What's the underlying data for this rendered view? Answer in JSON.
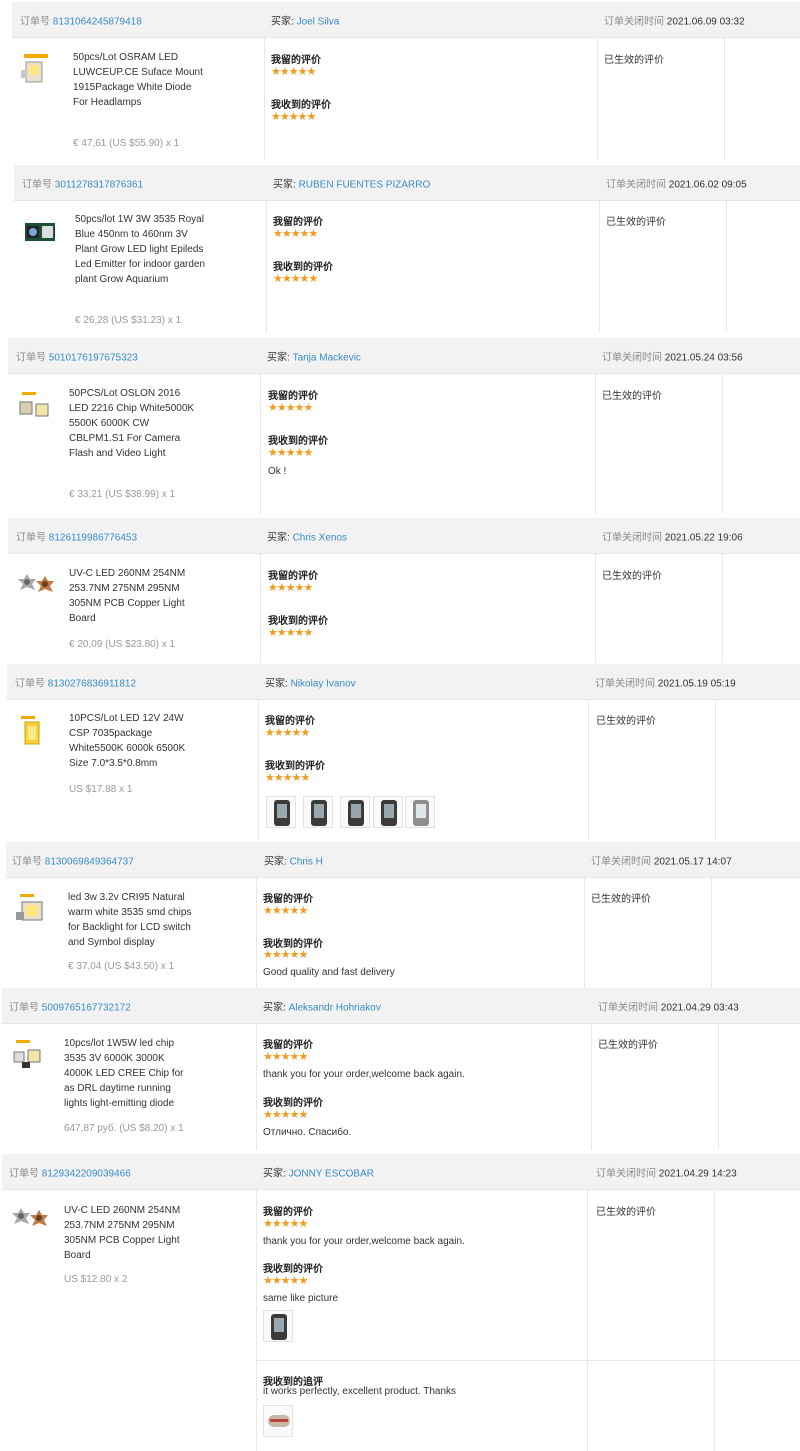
{
  "labels": {
    "order_no": "订单号",
    "buyer": "买家:",
    "close_time": "订单关闭时间",
    "left_review": "我留的评价",
    "received_review": "我收到的评价",
    "active_review": "已生效的评价",
    "followup_review": "我收到的追评",
    "stars": "★★★★★"
  },
  "colors": {
    "link": "#3a8cc8",
    "star": "#f39a1d",
    "header_bg": "#f2f2f2"
  },
  "orders": [
    {
      "order_no": "8131064245879418",
      "buyer": "Joel Silva",
      "close_time": "2021.06.09 03:32",
      "product": "50pcs/Lot OSRAM LED LUWCEUP.CE Suface Mount 1915Package White Diode For Headlamps",
      "price": "€ 47,61 (US $55.90) x 1",
      "thumb_icon": "smd-led-chip-icon"
    },
    {
      "order_no": "3011278317876361",
      "buyer": "RUBEN FUENTES PIZARRO",
      "close_time": "2021.06.02 09:05",
      "product": "50pcs/lot 1W 3W 3535 Royal Blue 450nm to 460nm 3V Plant Grow LED light Epileds Led Emitter for indoor garden plant Grow Aquarium",
      "price": "€ 26,28 (US $31.23) x 1",
      "thumb_icon": "led-emitter-board-icon"
    },
    {
      "order_no": "5010176197675323",
      "buyer": "Tanja Mackevic",
      "close_time": "2021.05.24 03:56",
      "product": "50PCS/Lot OSLON 2016 LED 2216 Chip White5000K 5500K 6000K CW CBLPM1.S1 For Camera Flash and Video Light",
      "price": "€ 33,21 (US $38.99) x 1",
      "thumb_icon": "led-chip-pair-icon",
      "received_text": "Ok !"
    },
    {
      "order_no": "8126119986776453",
      "buyer": "Chris Xenos",
      "close_time": "2021.05.22 19:06",
      "product": "UV-C LED 260NM 254NM 253.7NM 275NM 295NM 305NM PCB Copper Light Board",
      "price": "€ 20,09 (US $23.80) x 1",
      "thumb_icon": "copper-star-board-icon"
    },
    {
      "order_no": "8130276836911812",
      "buyer": "Nikolay Ivanov",
      "close_time": "2021.05.19 05:19",
      "product": "10PCS/Lot LED 12V 24W CSP 7035package White5500K 6000k 6500K Size 7.0*3.5*0.8mm",
      "price": "US $17.88 x 1",
      "thumb_icon": "csp-led-strip-icon"
    },
    {
      "order_no": "8130069849364737",
      "buyer": "Chris H",
      "close_time": "2021.05.17 14:07",
      "product": "led 3w 3.2v CRI95 Natural warm white 3535 smd chips for Backlight for LCD switch and Symbol display",
      "price": "€ 37,04 (US $43.50) x 1",
      "thumb_icon": "smd-led-chip-icon",
      "received_text": "Good quality and fast delivery"
    },
    {
      "order_no": "5009765167732172",
      "buyer": "Aleksandr Hohriakov",
      "close_time": "2021.04.29 03:43",
      "product": "10pcs/lot 1W5W led chip 3535 3V 6000K 3000K 4000K LED CREE Chip for as DRL daytime running lights light-emitting diode",
      "price": "647,87 руб. (US $8.20) x 1",
      "thumb_icon": "led-chip-pair-icon",
      "left_text": "thank you for your order,welcome back again.",
      "received_text": "Отлично. Спасибо."
    },
    {
      "order_no": "8129342209039466",
      "buyer": "JONNY ESCOBAR",
      "close_time": "2021.04.29 14:23",
      "product": "UV-C LED 260NM 254NM 253.7NM 275NM 295NM 305NM PCB Copper Light Board",
      "price": "US $12.80 x 2",
      "thumb_icon": "copper-star-board-icon",
      "left_text": "thank you for your order,welcome back again.",
      "received_text": "same like picture",
      "followup_text": "it works perfectly, excellent product. Thanks"
    }
  ]
}
